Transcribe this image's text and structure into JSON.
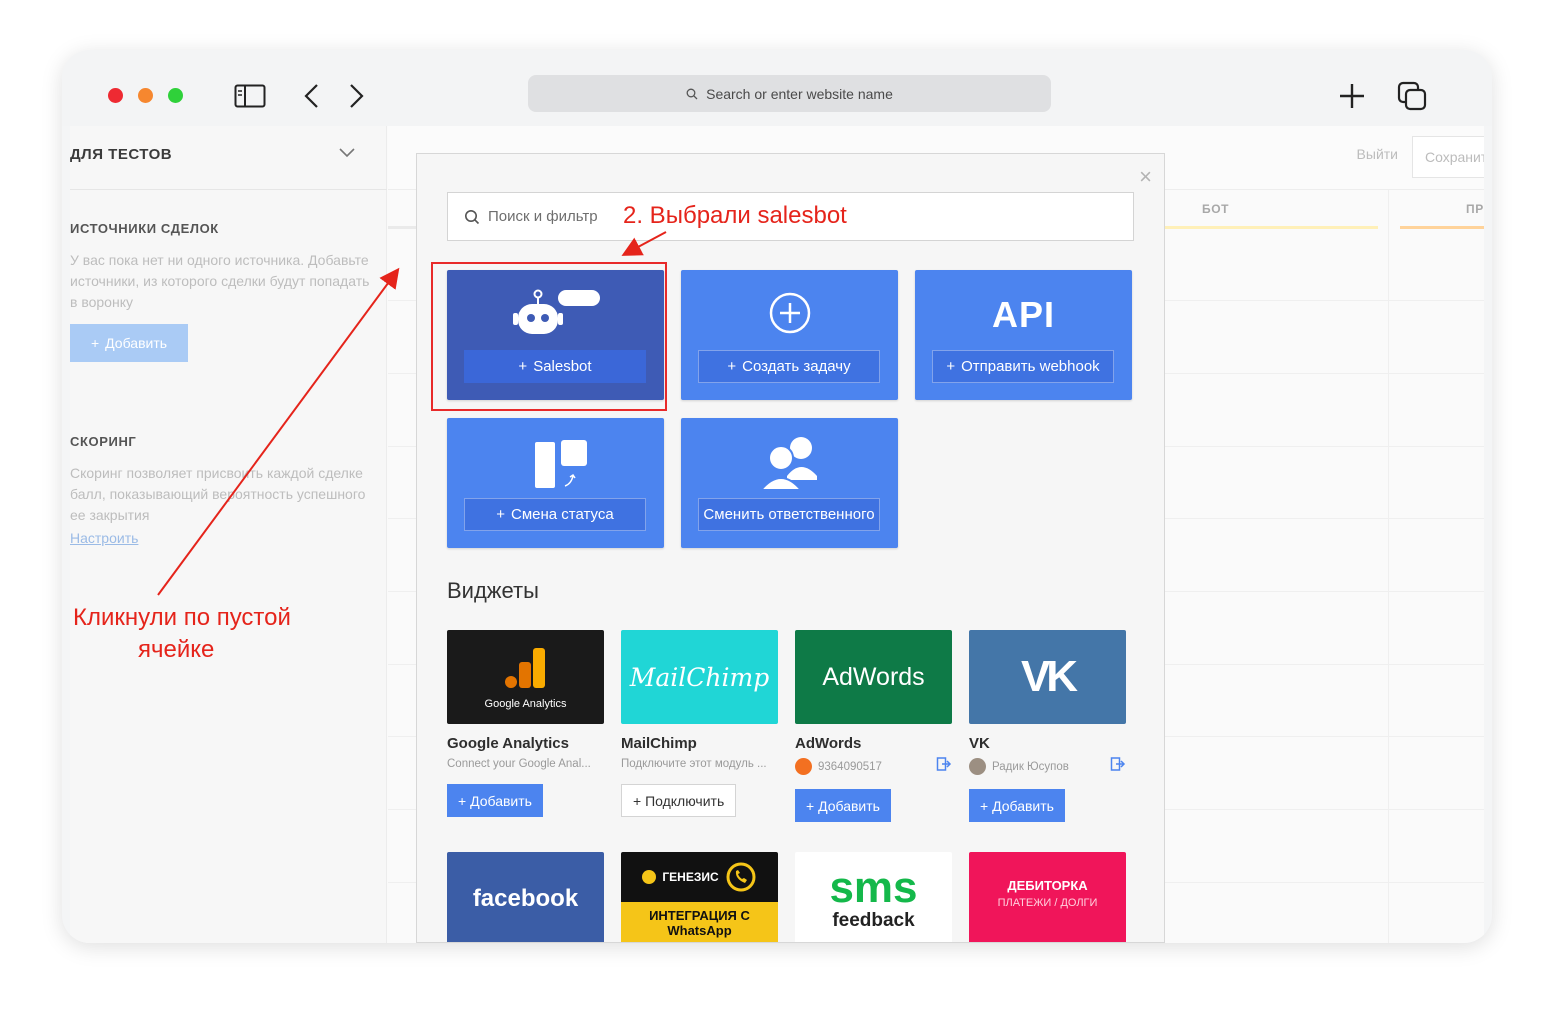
{
  "browser": {
    "url_placeholder": "Search or enter website name"
  },
  "sidebar": {
    "title": "ДЛЯ ТЕСТОВ",
    "sources_title": "ИСТОЧНИКИ СДЕЛОК",
    "sources_text": "У вас пока нет ни одного источника. Добавьте источники, из которого сделки будут попадать в воронку",
    "add_button": "Добавить",
    "scoring_title": "СКОРИНГ",
    "scoring_text": "Скоринг позволяет присвоить каждой сделке балл, показывающий вероятность успешного ее закрытия",
    "configure_link": "Настроить"
  },
  "pipeline": {
    "exit_label": "Выйти",
    "save_label": "Сохранить",
    "columns": [
      "БОТ",
      "ПР"
    ]
  },
  "modal": {
    "search_placeholder": "Поиск и фильтр",
    "tiles": [
      {
        "label": "Salesbot"
      },
      {
        "label": "Создать задачу"
      },
      {
        "label": "Отправить webhook",
        "icon_text": "API"
      },
      {
        "label": "Смена статуса"
      },
      {
        "label": "Сменить ответственного"
      }
    ],
    "widgets_title": "Виджеты",
    "widgets": [
      {
        "name": "Google Analytics",
        "desc": "Connect your Google Anal...",
        "button": "+ Добавить",
        "logo_text": "Google Analytics"
      },
      {
        "name": "MailChimp",
        "desc": "Подключите этот модуль ...",
        "button": "+ Подключить",
        "logo_text": "MailChimp"
      },
      {
        "name": "AdWords",
        "desc": "9364090517",
        "button": "+ Добавить",
        "logo_text": "AdWords"
      },
      {
        "name": "VK",
        "desc": "Радик Юсупов",
        "button": "+ Добавить",
        "logo_text": "VK"
      }
    ],
    "widgets_row2": [
      {
        "logo_text": "facebook"
      },
      {
        "logo_text_1": "ГЕНЕЗИС",
        "logo_text_2": "ИНТЕГРАЦИЯ С",
        "logo_text_3": "WhatsApp"
      },
      {
        "logo_text_1": "sms",
        "logo_text_2": "feedback"
      },
      {
        "logo_text_1": "ДЕБИТОРКА",
        "logo_text_2": "ПЛАТЕЖИ / ДОЛГИ"
      }
    ]
  },
  "annotations": {
    "step2": "2. Выбрали salesbot",
    "step1_line1": "Кликнули по пустой",
    "step1_line2": "ячейке"
  },
  "colors": {
    "accent": "#4c84ef",
    "salesbot_tile": "#3e5bb5",
    "annotation": "#e5241b"
  }
}
